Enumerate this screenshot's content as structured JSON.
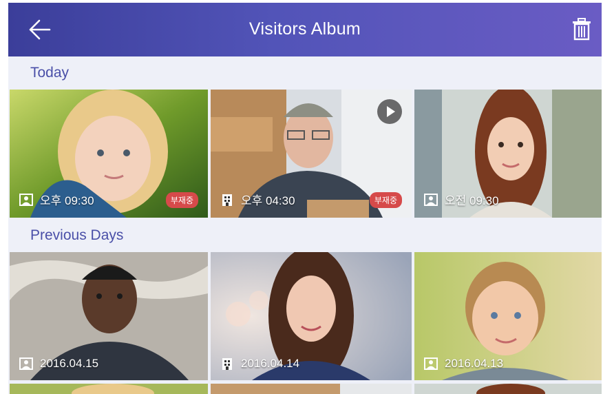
{
  "header": {
    "title": "Visitors Album",
    "back_icon": "arrow-left-icon",
    "delete_icon": "trash-icon"
  },
  "sections": [
    {
      "label": "Today",
      "items": [
        {
          "type_icon": "person-icon",
          "time": "오후 09:30",
          "badge": "부재중",
          "has_video": false
        },
        {
          "type_icon": "building-icon",
          "time": "오후 04:30",
          "badge": "부재중",
          "has_video": true
        },
        {
          "type_icon": "person-icon",
          "time": "오전 09:30",
          "badge": "",
          "has_video": false
        }
      ]
    },
    {
      "label": "Previous Days",
      "items": [
        {
          "type_icon": "person-icon",
          "time": "2016.04.15",
          "badge": "",
          "has_video": false
        },
        {
          "type_icon": "building-icon",
          "time": "2016.04.14",
          "badge": "",
          "has_video": false
        },
        {
          "type_icon": "person-icon",
          "time": "2016.04.13",
          "badge": "",
          "has_video": false
        }
      ]
    }
  ],
  "colors": {
    "header_start": "#3b3e9a",
    "header_end": "#6a5cc4",
    "section_label": "#4a4fa8",
    "badge": "#d64a4a"
  }
}
